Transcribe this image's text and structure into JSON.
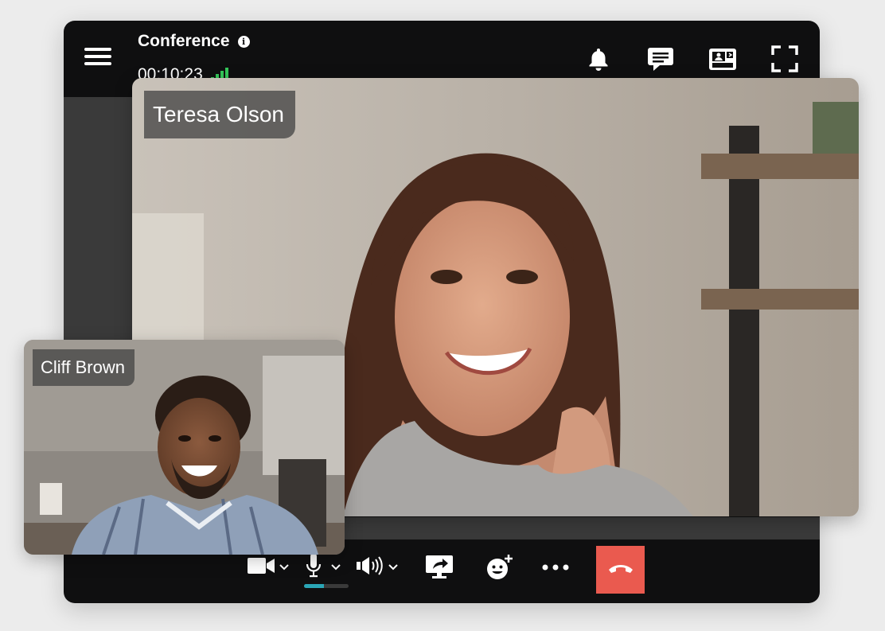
{
  "header": {
    "title": "Conference",
    "info_icon": "info-icon",
    "elapsed": "00:10:23",
    "signal_icon": "signal-strength-icon",
    "icons": [
      "bell-icon",
      "chat-icon",
      "layout-switch-icon",
      "fullscreen-icon"
    ]
  },
  "participants": [
    {
      "name": "Teresa Olson",
      "role": "main-speaker"
    },
    {
      "name": "Cliff Brown",
      "role": "self-view"
    }
  ],
  "controls": {
    "icons": [
      "camera-icon",
      "microphone-icon",
      "speaker-icon",
      "share-screen-icon",
      "reaction-icon",
      "more-icon",
      "hang-up-icon"
    ],
    "mic_level": 0.45
  },
  "colors": {
    "app_bg": "#0f0f10",
    "signal": "#34c759",
    "mic_level": "#2aa6b6",
    "hangup": "#ea5a4f"
  }
}
